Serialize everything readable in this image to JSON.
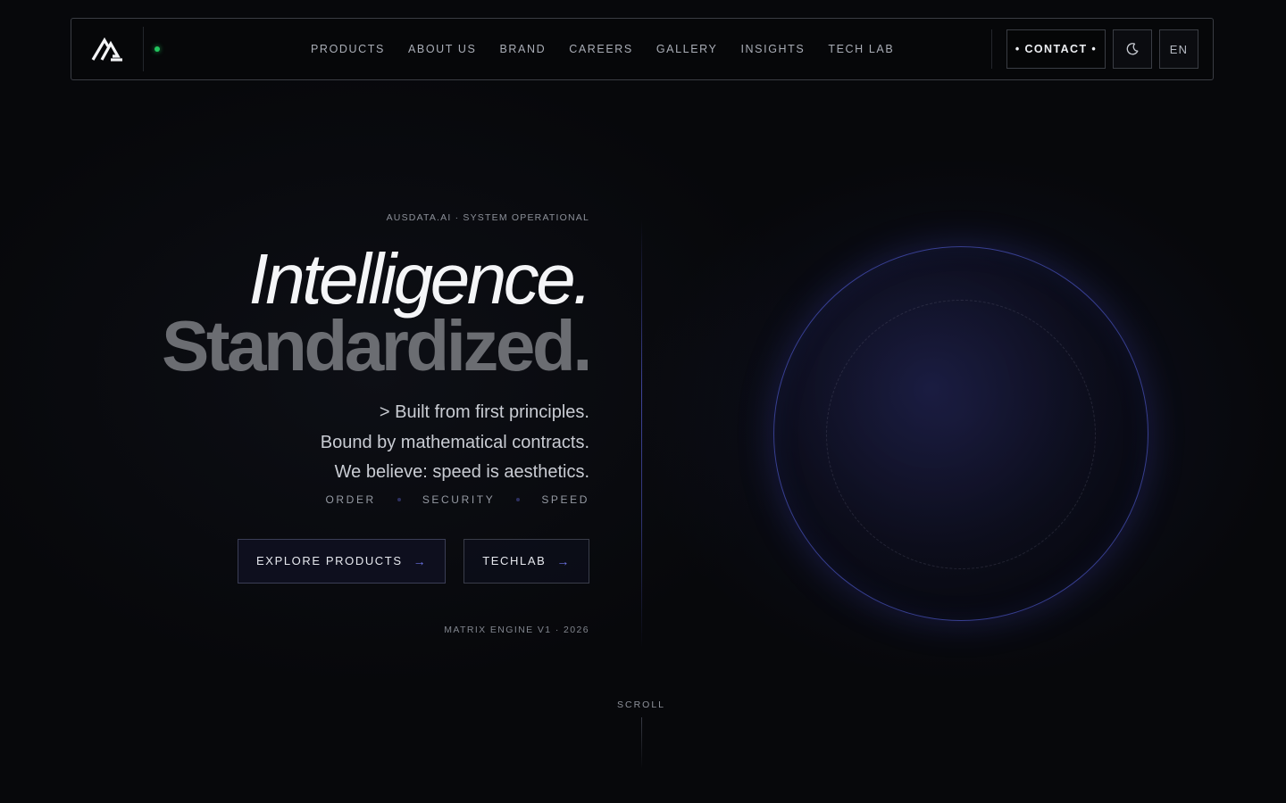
{
  "nav": {
    "logo": "ausdata-logo-icon",
    "status": "online",
    "links": [
      "PRODUCTS",
      "ABOUT US",
      "BRAND",
      "CAREERS",
      "GALLERY",
      "INSIGHTS",
      "TECH LAB"
    ],
    "contact_label": "• CONTACT •",
    "theme_icon": "moon-icon",
    "lang_label": "EN"
  },
  "hero": {
    "eyebrow": "AUSDATA.AI · SYSTEM OPERATIONAL",
    "headline_1": "Intelligence.",
    "headline_2": "Standardized.",
    "desc_lines": [
      "> Built from first principles.",
      "Bound by mathematical contracts.",
      "We believe: speed is aesthetics."
    ],
    "pillars": [
      "ORDER",
      "SECURITY",
      "SPEED"
    ],
    "cta_primary": "EXPLORE PRODUCTS",
    "cta_secondary": "TECHLAB",
    "arrow_icon": "arrow-right-icon",
    "meta": "MATRIX ENGINE V1 · 2026"
  },
  "scroll_label": "SCROLL",
  "colors": {
    "background": "#07080b",
    "accent": "#6e74e8",
    "status": "#22c55e"
  }
}
